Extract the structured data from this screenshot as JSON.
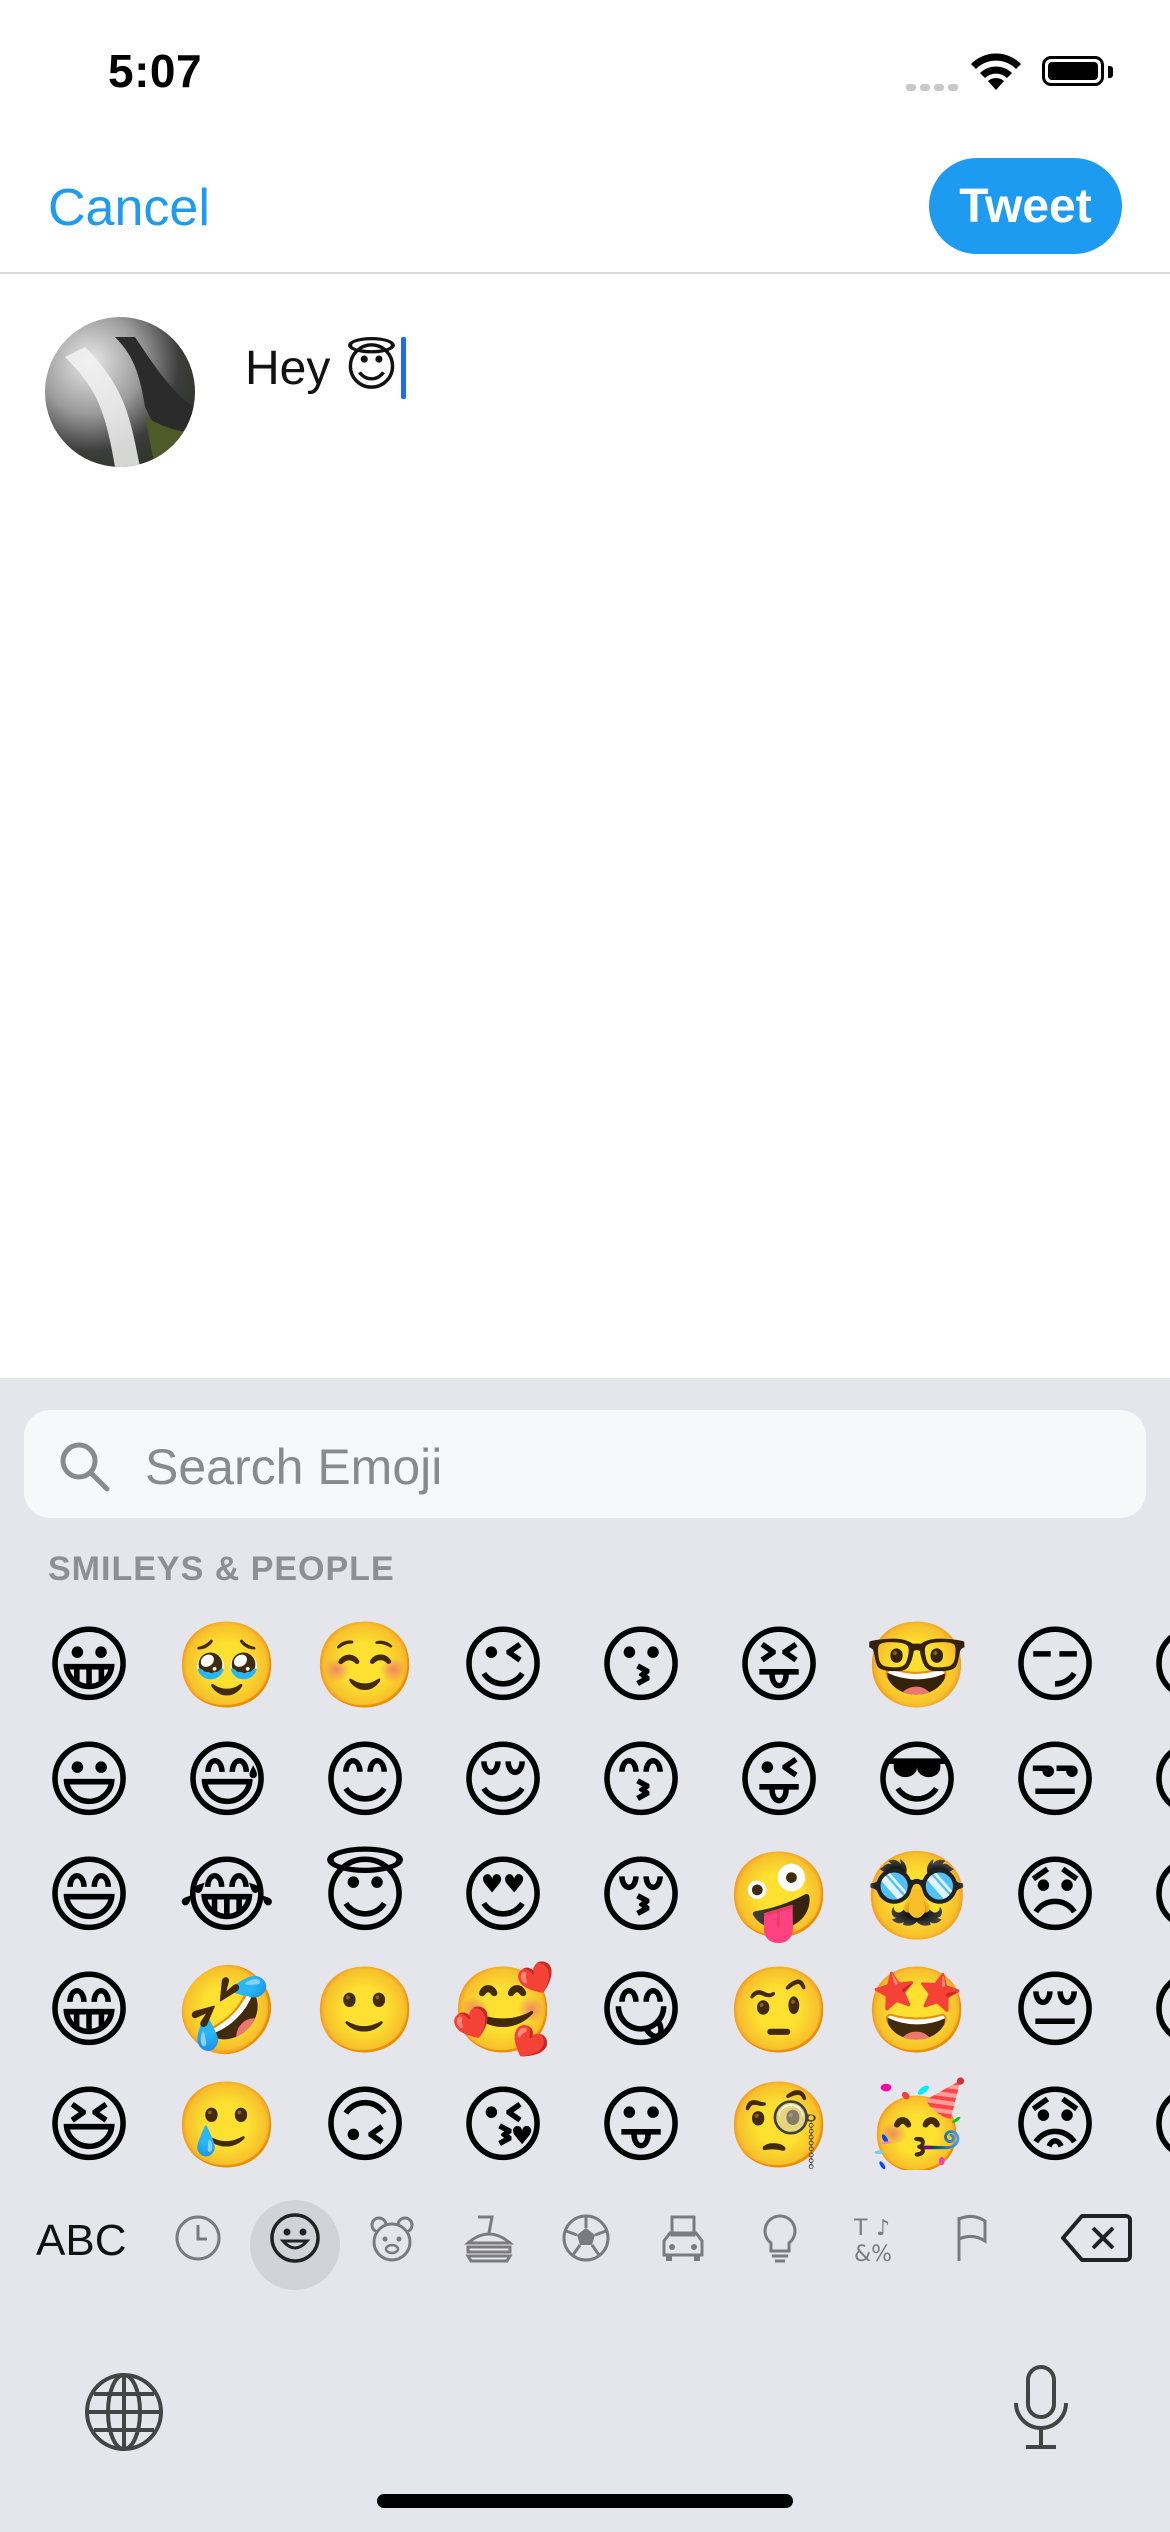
{
  "status_bar": {
    "time": "5:07"
  },
  "nav": {
    "cancel_label": "Cancel",
    "tweet_label": "Tweet"
  },
  "compose": {
    "text": "Hey",
    "emoji": "😇"
  },
  "keyboard": {
    "search_placeholder": "Search Emoji",
    "section_title": "SMILEYS & PEOPLE",
    "emoji_rows": [
      [
        "😀",
        "🥹",
        "☺️",
        "😉",
        "😗",
        "😝",
        "🤓",
        "😏",
        "😒"
      ],
      [
        "😃",
        "😅",
        "😊",
        "😌",
        "😙",
        "😜",
        "😎",
        "😒",
        "😞"
      ],
      [
        "😄",
        "😂",
        "😇",
        "😍",
        "😚",
        "🤪",
        "🥸",
        "😞",
        "😔"
      ],
      [
        "😁",
        "🤣",
        "🙂",
        "🥰",
        "😋",
        "🤨",
        "🤩",
        "😔",
        "😟"
      ],
      [
        "😆",
        "🥲",
        "🙃",
        "😘",
        "😛",
        "🧐",
        "🥳",
        "😟",
        "😕"
      ]
    ],
    "abc_label": "ABC",
    "categories": [
      "recent-icon",
      "smileys-icon",
      "animals-icon",
      "food-icon",
      "activity-icon",
      "travel-icon",
      "objects-icon",
      "symbols-icon",
      "flags-icon"
    ],
    "active_category": "smileys-icon"
  },
  "colors": {
    "accent": "#1d9bf0",
    "keyboard_bg": "#e5e6eb"
  }
}
